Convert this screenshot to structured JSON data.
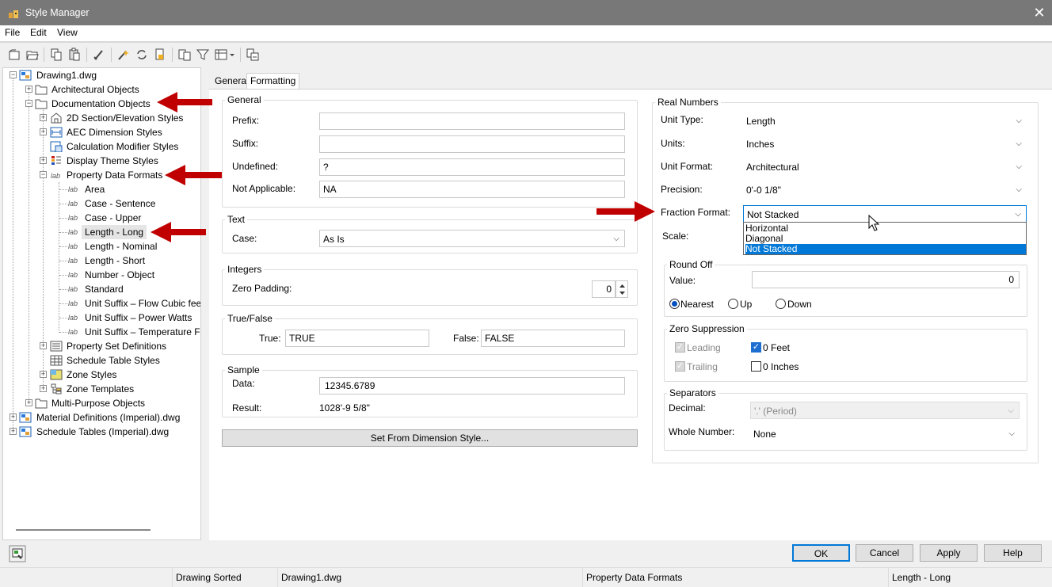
{
  "window": {
    "title": "Style Manager",
    "close_glyph": "✕"
  },
  "menu": [
    "File",
    "Edit",
    "View"
  ],
  "toolbar_icons": [
    "new-icon",
    "open-icon",
    "copy-icon",
    "paste-icon",
    "purge-icon",
    "edit-icon",
    "sync-icon",
    "set-from-icon",
    "toggle-view-icon",
    "filter-icon",
    "view-dropdown-icon",
    "inline-edit-icon"
  ],
  "tree": {
    "root": "Drawing1.dwg",
    "architectural": "Architectural Objects",
    "documentation": "Documentation Objects",
    "section_elev": "2D Section/Elevation Styles",
    "aec_dim": "AEC Dimension Styles",
    "calc_mod": "Calculation Modifier Styles",
    "display_theme": "Display Theme Styles",
    "property_formats": "Property Data Formats",
    "formats": [
      "Area",
      "Case - Sentence",
      "Case - Upper",
      "Length - Long",
      "Length - Nominal",
      "Length - Short",
      "Number - Object",
      "Standard",
      "Unit Suffix – Flow Cubic feet",
      "Unit Suffix – Power Watts",
      "Unit Suffix – Temperature Fa"
    ],
    "property_sets": "Property Set Definitions",
    "schedule_table": "Schedule Table Styles",
    "zone_styles": "Zone Styles",
    "zone_templates": "Zone Templates",
    "multi_purpose": "Multi-Purpose Objects",
    "material_defs": "Material Definitions (Imperial).dwg",
    "schedule_tables": "Schedule Tables (Imperial).dwg",
    "lab_glyph": "lab"
  },
  "tabs": {
    "general": "General",
    "formatting": "Formatting"
  },
  "general": {
    "title": "General",
    "prefix_label": "Prefix:",
    "prefix_value": "",
    "suffix_label": "Suffix:",
    "suffix_value": "",
    "undefined_label": "Undefined:",
    "undefined_value": "?",
    "na_label": "Not Applicable:",
    "na_value": "NA"
  },
  "text": {
    "title": "Text",
    "case_label": "Case:",
    "case_value": "As Is"
  },
  "integers": {
    "title": "Integers",
    "zero_padding_label": "Zero Padding:",
    "zero_padding_value": "0"
  },
  "truefalse": {
    "title": "True/False",
    "true_label": "True:",
    "true_value": "TRUE",
    "false_label": "False:",
    "false_value": "FALSE"
  },
  "sample": {
    "title": "Sample",
    "data_label": "Data:",
    "data_value": "12345.6789",
    "result_label": "Result:",
    "result_value": "1028'-9 5/8\""
  },
  "set_from_dim": "Set From Dimension Style...",
  "real": {
    "title": "Real Numbers",
    "unit_type_label": "Unit Type:",
    "unit_type_value": "Length",
    "units_label": "Units:",
    "units_value": "Inches",
    "unit_format_label": "Unit Format:",
    "unit_format_value": "Architectural",
    "precision_label": "Precision:",
    "precision_value": "0'-0 1/8\"",
    "fraction_label": "Fraction Format:",
    "fraction_value": "Not Stacked",
    "fraction_options": [
      "Horizontal",
      "Diagonal",
      "Not Stacked"
    ],
    "scale_label": "Scale:"
  },
  "roundoff": {
    "title": "Round Off",
    "value_label": "Value:",
    "value": "0",
    "nearest": "Nearest",
    "up": "Up",
    "down": "Down",
    "selected": "Nearest"
  },
  "zero": {
    "title": "Zero Suppression",
    "leading": "Leading",
    "trailing": "Trailing",
    "feet": "0 Feet",
    "inches": "0 Inches",
    "leading_checked": true,
    "trailing_checked": true,
    "feet_checked": true,
    "inches_checked": false
  },
  "separators": {
    "title": "Separators",
    "decimal_label": "Decimal:",
    "decimal_value": "'.' (Period)",
    "whole_label": "Whole Number:",
    "whole_value": "None"
  },
  "buttons": {
    "ok": "OK",
    "cancel": "Cancel",
    "apply": "Apply",
    "help": "Help"
  },
  "status": {
    "sort": "Drawing Sorted",
    "file": "Drawing1.dwg",
    "category": "Property Data Formats",
    "item": "Length - Long"
  },
  "colors": {
    "accent": "#0078d7",
    "annotation_arrow": "#c00000",
    "titlebar": "#787878"
  }
}
